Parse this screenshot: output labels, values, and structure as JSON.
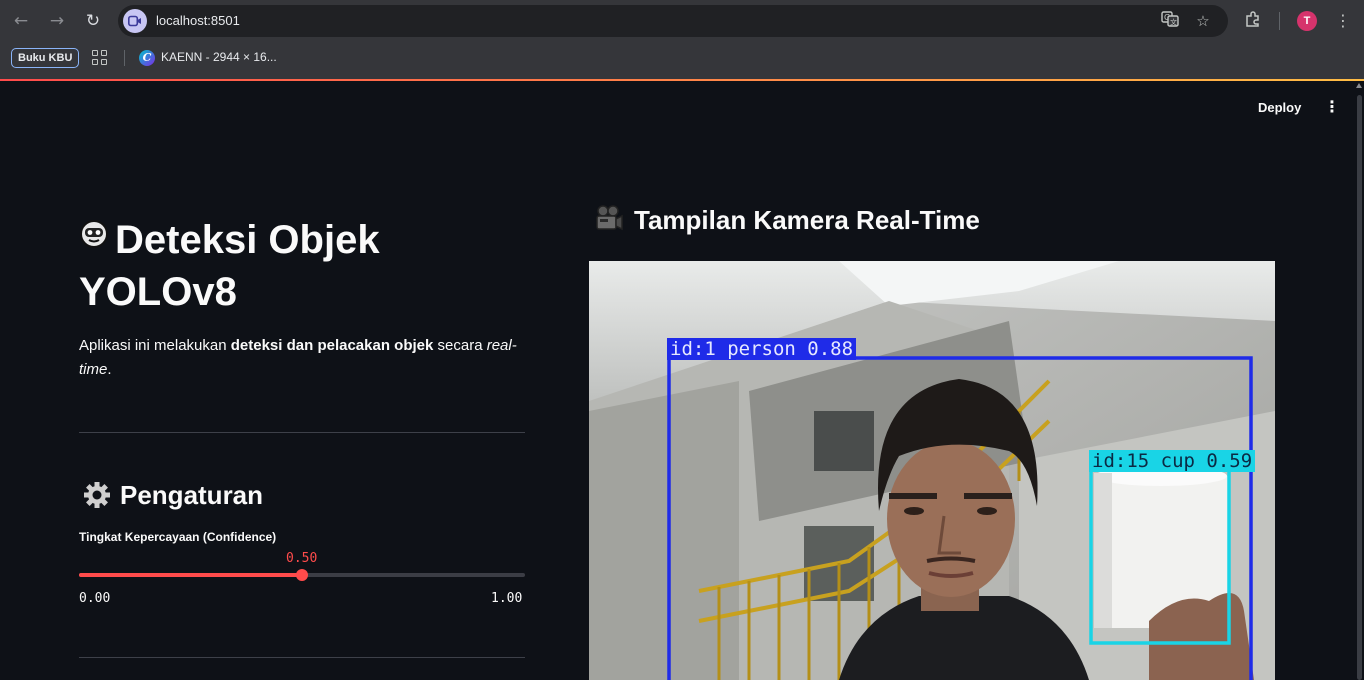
{
  "browser": {
    "url": "localhost:8501",
    "profile_initial": "T",
    "bookmarks": [
      {
        "label": "Buku KBU"
      },
      {
        "label": "KAENN - 2944 × 16..."
      }
    ],
    "icons": [
      "back-icon",
      "forward-icon",
      "reload-icon",
      "site-info-icon",
      "translate-icon",
      "star-icon",
      "extensions-icon",
      "menu-icon",
      "apps-grid-icon"
    ]
  },
  "app": {
    "deploy_label": "Deploy",
    "title_line1": "Deteksi Objek",
    "title_line2": "YOLOv8",
    "desc": {
      "prefix": "Aplikasi ini melakukan ",
      "bold": "deteksi dan pelacakan objek",
      "middle": " secara ",
      "italic": "real-time",
      "suffix": "."
    },
    "settings_heading": "Pengaturan",
    "slider": {
      "label": "Tingkat Kepercayaan (Confidence)",
      "value": 0.5,
      "value_text": "0.50",
      "min_text": "0.00",
      "max_text": "1.00"
    },
    "camera_heading": "Tampilan Kamera Real-Time",
    "detections": [
      {
        "label": "id:1 person 0.88",
        "color": "#1f2be8"
      },
      {
        "label": "id:15 cup 0.59",
        "color": "#19d4e6"
      }
    ]
  },
  "colors": {
    "accent": "#ff4b4b",
    "background": "#0e1117",
    "person_box": "#1f2be8",
    "cup_box": "#19d4e6"
  }
}
